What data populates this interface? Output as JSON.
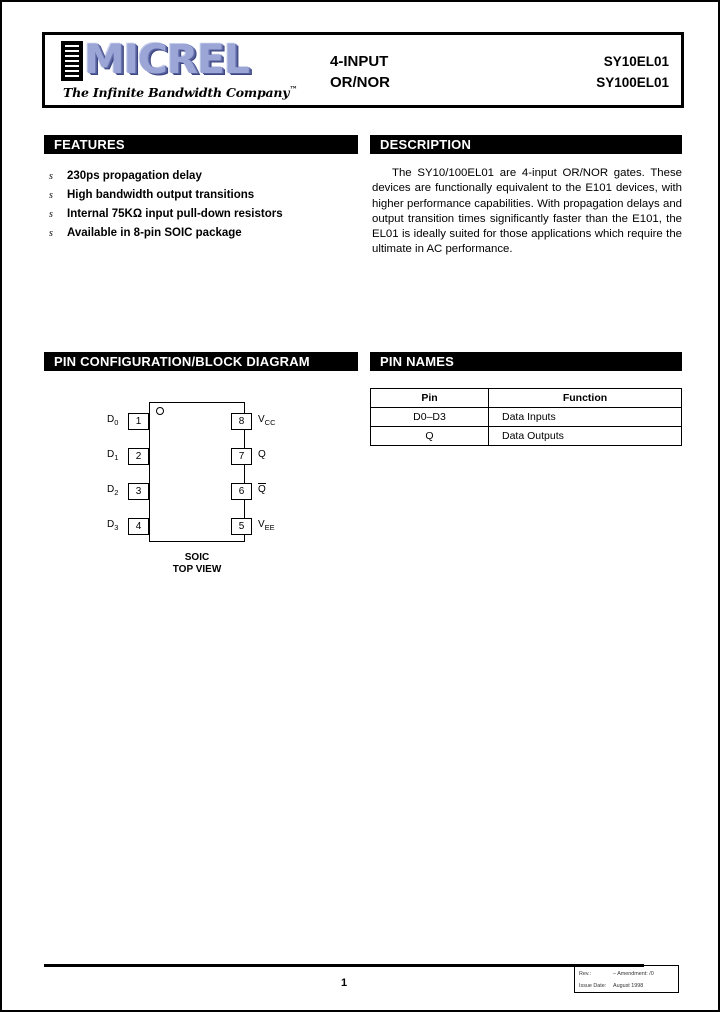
{
  "header": {
    "logo_text": "MICREL",
    "logo_tagline": "The Infinite Bandwidth Company",
    "logo_tm": "™",
    "title_line1": "4-INPUT",
    "title_line2": "OR/NOR",
    "part_line1": "SY10EL01",
    "part_line2": "SY100EL01"
  },
  "sections": {
    "features_title": "FEATURES",
    "description_title": "DESCRIPTION",
    "pin_config_title": "PIN CONFIGURATION/BLOCK DIAGRAM",
    "pin_names_title": "PIN NAMES"
  },
  "features": {
    "bullet_glyph": "s",
    "items": [
      "230ps propagation delay",
      "High bandwidth output transitions",
      "Internal 75KΩ input pull-down resistors",
      "Available in 8-pin SOIC package"
    ]
  },
  "description": {
    "text": "The SY10/100EL01 are 4-input OR/NOR gates. These devices are functionally equivalent to the E101 devices, with higher performance capabilities. With propagation delays and output transition times significantly faster than the E101, the EL01 is ideally suited for those applications which require the ultimate in AC performance."
  },
  "pin_diagram": {
    "caption_line1": "SOIC",
    "caption_line2": "TOP VIEW",
    "left_pins": [
      {
        "number": "1",
        "label": "D",
        "sub": "0"
      },
      {
        "number": "2",
        "label": "D",
        "sub": "1"
      },
      {
        "number": "3",
        "label": "D",
        "sub": "2"
      },
      {
        "number": "4",
        "label": "D",
        "sub": "3"
      }
    ],
    "right_pins": [
      {
        "number": "8",
        "label": "V",
        "sub": "CC",
        "overline": false
      },
      {
        "number": "7",
        "label": "Q",
        "sub": "",
        "overline": false
      },
      {
        "number": "6",
        "label": "Q",
        "sub": "",
        "overline": true
      },
      {
        "number": "5",
        "label": "V",
        "sub": "EE",
        "overline": false
      }
    ]
  },
  "pin_names_table": {
    "headers": [
      "Pin",
      "Function"
    ],
    "rows": [
      {
        "pin": "D0–D3",
        "function": "Data Inputs"
      },
      {
        "pin": "Q",
        "function": "Data Outputs"
      }
    ]
  },
  "footer": {
    "page_number": "1",
    "rev_key": "Rev.:",
    "rev_value": "–        Amendment: /0",
    "issue_key": "Issue Date:",
    "issue_value": "August  1998"
  },
  "colors": {
    "logo_light": "#9ba5d6",
    "logo_dark": "#3c4680",
    "bar_bg": "#000000",
    "bar_fg": "#ffffff"
  }
}
